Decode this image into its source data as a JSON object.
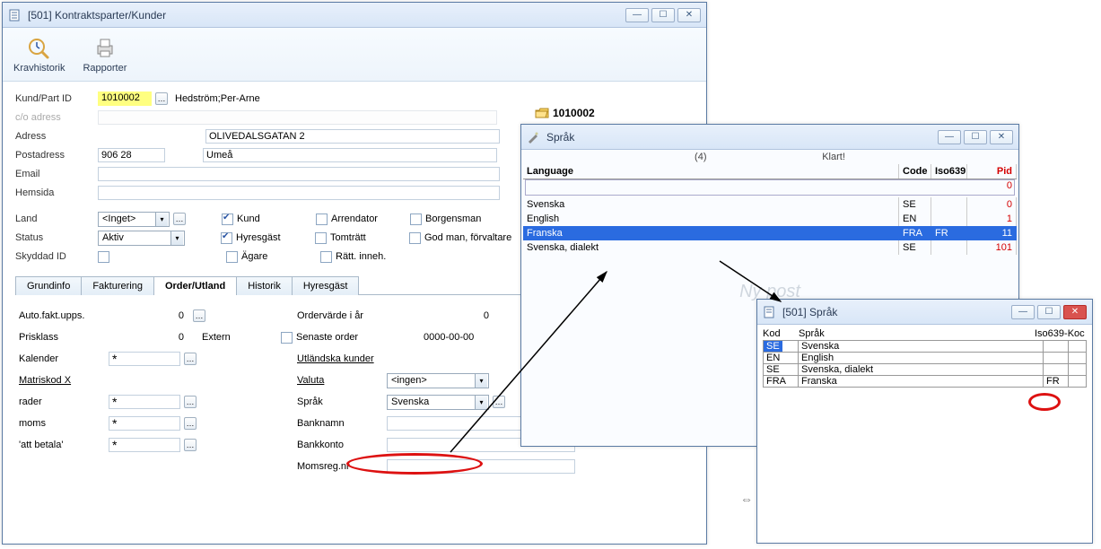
{
  "main_window": {
    "title": "[501]  Kontraktsparter/Kunder",
    "toolbar": {
      "btn1": "Kravhistorik",
      "btn2": "Rapporter"
    },
    "form": {
      "kund_label": "Kund/Part ID",
      "kund_value": "1010002",
      "kund_name": "Hedström;Per-Arne",
      "co_label": "c/o adress",
      "adress_label": "Adress",
      "adress_value": "OLIVEDALSGATAN 2",
      "postadress_label": "Postadress",
      "postadress_code": "906 28",
      "postadress_city": "Umeå",
      "email_label": "Email",
      "hemsida_label": "Hemsida",
      "land_label": "Land",
      "land_value": "<Inget>",
      "status_label": "Status",
      "status_value": "Aktiv",
      "skyddad_label": "Skyddad ID",
      "roles": {
        "kund": "Kund",
        "arrendator": "Arrendator",
        "borgensman": "Borgensman",
        "hyresgast": "Hyresgäst",
        "tomtratt": "Tomträtt",
        "godman": "God man, förvaltare",
        "agare": "Ägare",
        "ratt": "Rätt. inneh."
      }
    },
    "tabs": {
      "t1": "Grundinfo",
      "t2": "Fakturering",
      "t3": "Order/Utland",
      "t4": "Historik",
      "t5": "Hyresgäst"
    },
    "tabbody": {
      "left": {
        "auto_label": "Auto.fakt.upps.",
        "auto_val": "0",
        "prisklass_label": "Prisklass",
        "prisklass_val": "0",
        "extern_label": "Extern",
        "kalender_label": "Kalender",
        "kalender_val": "*",
        "matris_label": "Matriskod X",
        "rader_label": "rader",
        "rader_val": "*",
        "moms_label": "moms",
        "moms_val": "*",
        "att_label": "'att betala'",
        "att_val": "*"
      },
      "right": {
        "order_label": "Ordervärde i år",
        "order_val": "0",
        "senaste_label": "Senaste order",
        "senaste_val": "0000-00-00",
        "utland_label": "Utländska kunder",
        "valuta_label": "Valuta",
        "valuta_val": "<ingen>",
        "sprak_label": "Språk",
        "sprak_val": "Svenska",
        "banknamn_label": "Banknamn",
        "bankkonto_label": "Bankkonto",
        "momsreg_label": "Momsreg.nr"
      }
    }
  },
  "folder_label": "1010002",
  "popup1": {
    "title": "Språk",
    "count": "(4)",
    "status": "Klart!",
    "head": {
      "lang": "Language",
      "code": "Code",
      "iso": "Iso639",
      "pid": "Pid"
    },
    "empty_pid": "0",
    "rows": [
      {
        "lang": "Svenska",
        "code": "SE",
        "iso": "",
        "pid": "0"
      },
      {
        "lang": "English",
        "code": "EN",
        "iso": "",
        "pid": "1"
      },
      {
        "lang": "Franska",
        "code": "FRA",
        "iso": "FR",
        "pid": "11"
      },
      {
        "lang": "Svenska, dialekt",
        "code": "SE",
        "iso": "",
        "pid": "101"
      }
    ],
    "watermark": "Ny post"
  },
  "popup2": {
    "title": "[501]  Språk",
    "head": {
      "kod": "Kod",
      "sprak": "Språk",
      "iso": "Iso639-Koc"
    },
    "rows": [
      {
        "kod": "SE",
        "sprak": "Svenska",
        "iso": ""
      },
      {
        "kod": "EN",
        "sprak": "English",
        "iso": ""
      },
      {
        "kod": "SE",
        "sprak": "Svenska, dialekt",
        "iso": ""
      },
      {
        "kod": "FRA",
        "sprak": "Franska",
        "iso": "FR"
      }
    ]
  }
}
